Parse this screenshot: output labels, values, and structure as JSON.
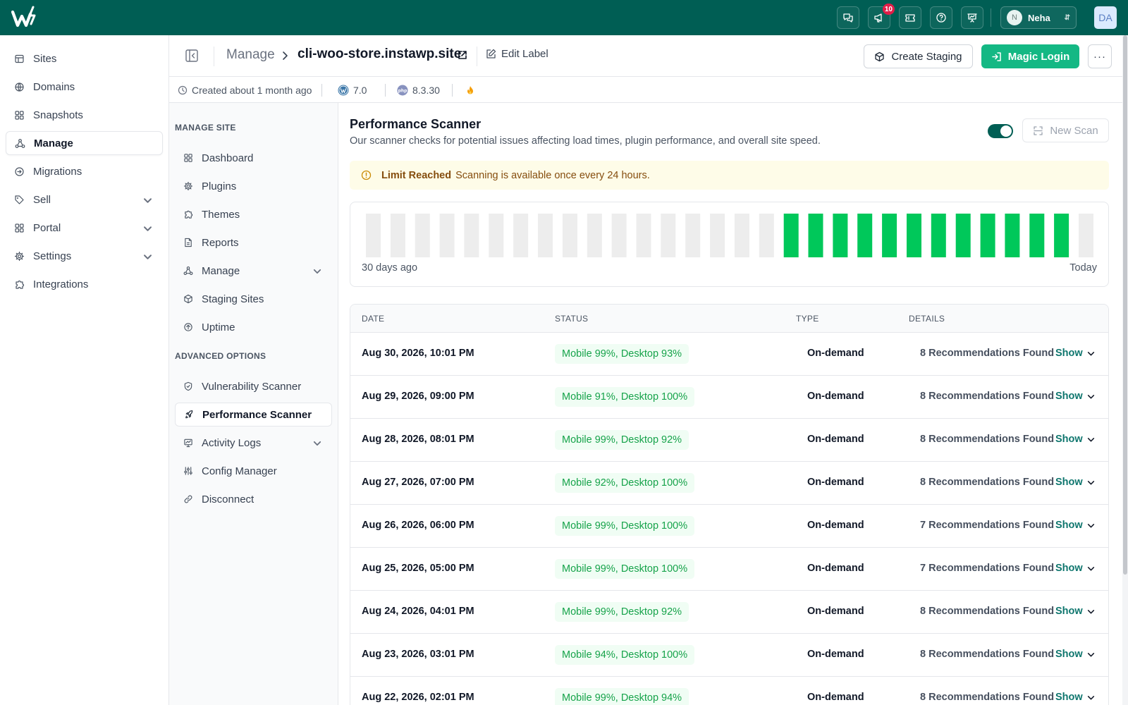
{
  "topbar": {
    "notification_count": "10",
    "user": {
      "initial": "N",
      "name": "Neha"
    },
    "account_initials": "DA"
  },
  "sidebar": {
    "items": [
      {
        "label": "Sites",
        "icon": "table-icon",
        "active": false,
        "has_chevron": false
      },
      {
        "label": "Domains",
        "icon": "globe-icon",
        "active": false,
        "has_chevron": false
      },
      {
        "label": "Snapshots",
        "icon": "grid-icon",
        "active": false,
        "has_chevron": false
      },
      {
        "label": "Manage",
        "icon": "sitemap-icon",
        "active": true,
        "has_chevron": false
      },
      {
        "label": "Migrations",
        "icon": "arrow-circle-icon",
        "active": false,
        "has_chevron": false
      },
      {
        "label": "Sell",
        "icon": "tag-icon",
        "active": false,
        "has_chevron": true
      },
      {
        "label": "Portal",
        "icon": "grid-icon",
        "active": false,
        "has_chevron": true
      },
      {
        "label": "Settings",
        "icon": "gear-icon",
        "active": false,
        "has_chevron": true
      },
      {
        "label": "Integrations",
        "icon": "puzzle-icon",
        "active": false,
        "has_chevron": false
      }
    ]
  },
  "header": {
    "breadcrumb_manage": "Manage",
    "site_name": "cli-woo-store.instawp.site",
    "edit_label": "Edit Label",
    "create_staging": "Create Staging",
    "magic_login": "Magic Login",
    "more": "···"
  },
  "meta": {
    "created": "Created about 1 month ago",
    "wp_version": "7.0",
    "php_version": "8.3.30",
    "php_badge": "php"
  },
  "subnav": {
    "manage_heading": "MANAGE SITE",
    "manage_items": [
      {
        "label": "Dashboard",
        "icon": "grid-icon",
        "has_chevron": false
      },
      {
        "label": "Plugins",
        "icon": "gear-icon",
        "has_chevron": false
      },
      {
        "label": "Themes",
        "icon": "puzzle-icon",
        "has_chevron": false
      },
      {
        "label": "Reports",
        "icon": "document-icon",
        "has_chevron": false
      },
      {
        "label": "Manage",
        "icon": "sitemap-icon",
        "has_chevron": true
      },
      {
        "label": "Staging Sites",
        "icon": "cube-icon",
        "has_chevron": false
      },
      {
        "label": "Uptime",
        "icon": "arrow-up-circle-icon",
        "has_chevron": false
      }
    ],
    "advanced_heading": "ADVANCED OPTIONS",
    "advanced_items": [
      {
        "label": "Vulnerability Scanner",
        "icon": "shield-icon",
        "active": false,
        "has_chevron": false
      },
      {
        "label": "Performance Scanner",
        "icon": "rocket-icon",
        "active": true,
        "has_chevron": false
      },
      {
        "label": "Activity Logs",
        "icon": "chart-icon",
        "active": false,
        "has_chevron": true
      },
      {
        "label": "Config Manager",
        "icon": "sliders-icon",
        "active": false,
        "has_chevron": false
      },
      {
        "label": "Disconnect",
        "icon": "link-icon",
        "active": false,
        "has_chevron": false
      }
    ]
  },
  "scanner": {
    "title": "Performance Scanner",
    "description": "Our scanner checks for potential issues affecting load times, plugin performance, and overall site speed.",
    "toggle_on": true,
    "new_scan": "New Scan",
    "alert_title": "Limit Reached",
    "alert_text": "Scanning is available once every 24 hours.",
    "history_label_start": "30 days ago",
    "history_label_end": "Today",
    "history_days": [
      0,
      0,
      0,
      0,
      0,
      0,
      0,
      0,
      0,
      0,
      0,
      0,
      0,
      0,
      0,
      0,
      0,
      1,
      1,
      1,
      1,
      1,
      1,
      1,
      1,
      1,
      1,
      1,
      1,
      0
    ],
    "colors": {
      "scanned": "#00c85a",
      "empty": "#ededed"
    }
  },
  "table": {
    "headers": {
      "date": "DATE",
      "status": "STATUS",
      "type": "TYPE",
      "details": "DETAILS"
    },
    "show_label": "Show",
    "rows": [
      {
        "date": "Aug 30, 2026, 10:01 PM",
        "status": "Mobile 99%, Desktop 93%",
        "type": "On-demand",
        "details": "8 Recommendations Found"
      },
      {
        "date": "Aug 29, 2026, 09:00 PM",
        "status": "Mobile 91%, Desktop 100%",
        "type": "On-demand",
        "details": "8 Recommendations Found"
      },
      {
        "date": "Aug 28, 2026, 08:01 PM",
        "status": "Mobile 99%, Desktop 92%",
        "type": "On-demand",
        "details": "8 Recommendations Found"
      },
      {
        "date": "Aug 27, 2026, 07:00 PM",
        "status": "Mobile 92%, Desktop 100%",
        "type": "On-demand",
        "details": "8 Recommendations Found"
      },
      {
        "date": "Aug 26, 2026, 06:00 PM",
        "status": "Mobile 99%, Desktop 100%",
        "type": "On-demand",
        "details": "7 Recommendations Found"
      },
      {
        "date": "Aug 25, 2026, 05:00 PM",
        "status": "Mobile 99%, Desktop 100%",
        "type": "On-demand",
        "details": "7 Recommendations Found"
      },
      {
        "date": "Aug 24, 2026, 04:01 PM",
        "status": "Mobile 99%, Desktop 92%",
        "type": "On-demand",
        "details": "8 Recommendations Found"
      },
      {
        "date": "Aug 23, 2026, 03:01 PM",
        "status": "Mobile 94%, Desktop 100%",
        "type": "On-demand",
        "details": "8 Recommendations Found"
      },
      {
        "date": "Aug 22, 2026, 02:01 PM",
        "status": "Mobile 99%, Desktop 94%",
        "type": "On-demand",
        "details": "8 Recommendations Found"
      }
    ]
  }
}
